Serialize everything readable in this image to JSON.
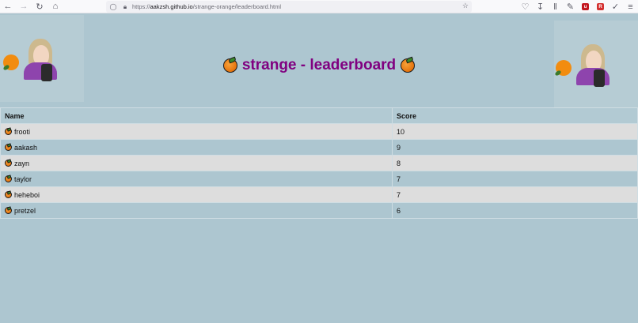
{
  "browser": {
    "url_prefix": "https://",
    "url_host": "aakzsh.github.io",
    "url_path": "/strange-orange/leaderboard.html"
  },
  "page": {
    "title": "strange - leaderboard"
  },
  "leaderboard": {
    "headers": {
      "name": "Name",
      "score": "Score"
    },
    "rows": [
      {
        "name": "frooti",
        "score": "10"
      },
      {
        "name": "aakash",
        "score": "9"
      },
      {
        "name": "zayn",
        "score": "8"
      },
      {
        "name": "taylor",
        "score": "7"
      },
      {
        "name": "heheboi",
        "score": "7"
      },
      {
        "name": "pretzel",
        "score": "6"
      }
    ]
  },
  "colors": {
    "background": "#adc6d0",
    "title": "#800080",
    "row_alt": "#dddddd"
  },
  "icons": [
    "back-arrow-icon",
    "forward-arrow-icon",
    "home-icon",
    "shield-icon",
    "lock-icon",
    "star-icon",
    "pocket-icon",
    "download-icon",
    "library-icon",
    "orange-emoji-icon"
  ]
}
